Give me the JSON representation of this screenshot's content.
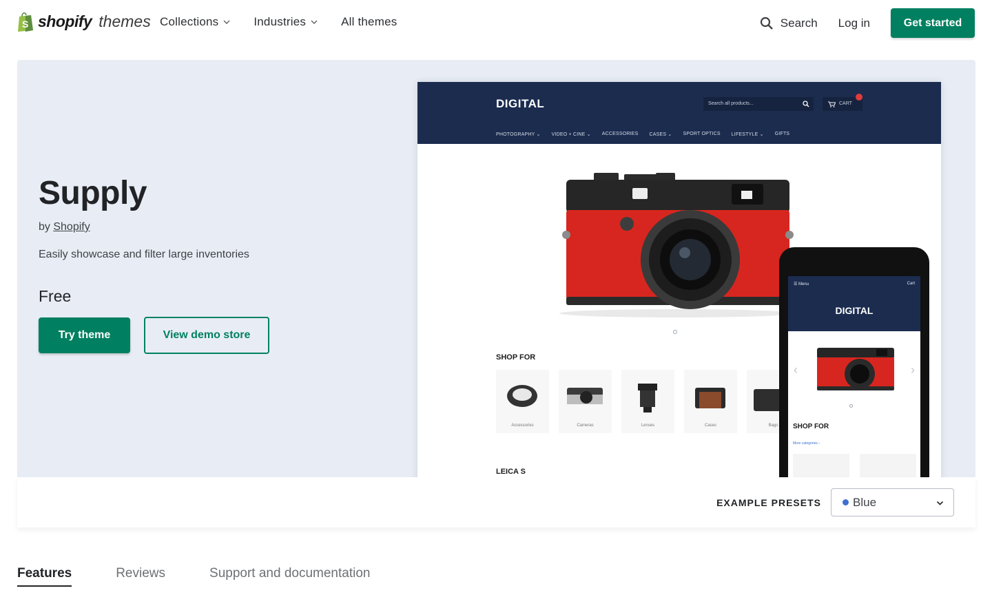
{
  "nav": {
    "logo_word": "shopify",
    "logo_sub": "themes",
    "links": [
      {
        "label": "Collections",
        "dropdown": true
      },
      {
        "label": "Industries",
        "dropdown": true
      },
      {
        "label": "All themes",
        "dropdown": false
      }
    ],
    "search_label": "Search",
    "login_label": "Log in",
    "cta_label": "Get started"
  },
  "hero": {
    "title": "Supply",
    "by_prefix": "by",
    "author": "Shopify",
    "description": "Easily showcase and filter large inventories",
    "price": "Free",
    "try_label": "Try theme",
    "demo_label": "View demo store"
  },
  "preview": {
    "store_logo": "DIGITAL",
    "search_placeholder": "Search all products...",
    "cart_label": "CART",
    "menu": [
      "PHOTOGRAPHY ⌄",
      "VIDEO + CINE ⌄",
      "ACCESSORIES",
      "CASES ⌄",
      "SPORT OPTICS",
      "LIFESTYLE ⌄",
      "GIFTS"
    ],
    "shop_for": "SHOP FOR",
    "categories": [
      "Accessories",
      "Cameras",
      "Lenses",
      "Cases",
      "Bags"
    ],
    "section_title": "LEICA S",
    "mobile": {
      "menu_label": "☰ Menu",
      "cart_label": "Cart",
      "logo": "DIGITAL",
      "shop_for": "SHOP FOR",
      "more_link": "More categories ›"
    }
  },
  "presets": {
    "label": "EXAMPLE PRESETS",
    "selected": "Blue",
    "selected_color": "#3f6fd1"
  },
  "tabs": [
    {
      "label": "Features",
      "active": true
    },
    {
      "label": "Reviews",
      "active": false
    },
    {
      "label": "Support and documentation",
      "active": false
    }
  ],
  "colors": {
    "brand_green": "#008060",
    "hero_bg": "#e8edf5",
    "store_navy": "#1b2c4f"
  }
}
